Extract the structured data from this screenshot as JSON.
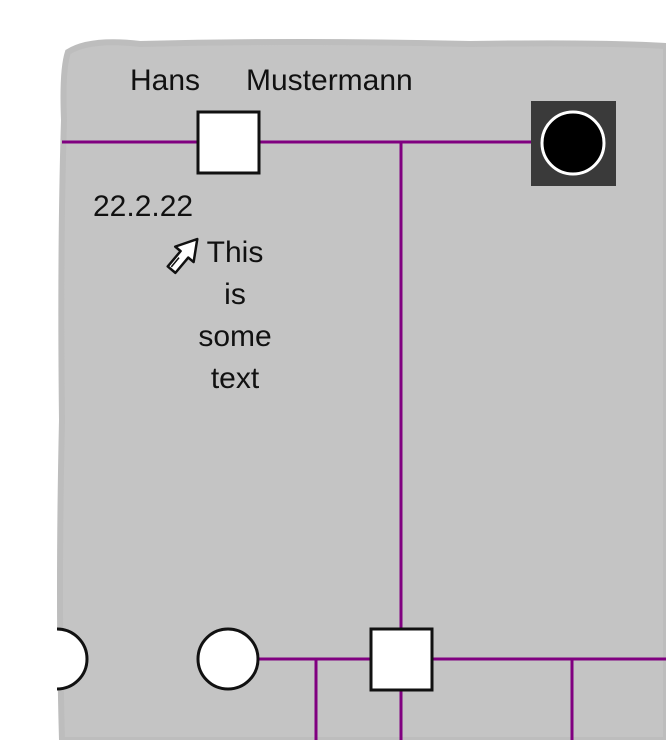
{
  "colors": {
    "background": "#ffffff",
    "panel": "#c4c4c4",
    "line": "#800080",
    "symbol_fill": "#ffffff",
    "symbol_stroke": "#111111",
    "selected_bg": "#3a3a3a",
    "selected_fill": "#000000",
    "connector_highlight": "#7cff7c"
  },
  "person": {
    "first_name": "Hans",
    "last_name": "Mustermann",
    "date": "22.2.22"
  },
  "note": {
    "lines": [
      "This",
      "is",
      "some",
      "text"
    ]
  },
  "icons": {
    "annotation": "pencil-cursor-icon"
  }
}
